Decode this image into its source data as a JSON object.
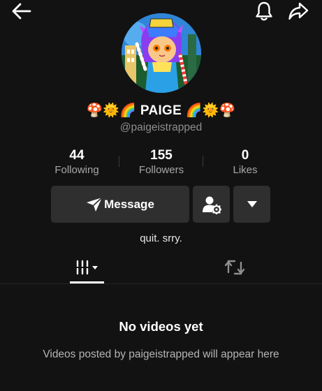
{
  "profile": {
    "display_name": "🍄🌞🌈 PAIGE 🌈🌞🍄",
    "handle": "@paigeistrapped",
    "bio": "quit. srry."
  },
  "stats": {
    "following_count": "44",
    "following_label": "Following",
    "followers_count": "155",
    "followers_label": "Followers",
    "likes_count": "0",
    "likes_label": "Likes"
  },
  "actions": {
    "message_label": "Message"
  },
  "empty_state": {
    "title": "No videos yet",
    "subtitle": "Videos posted by paigeistrapped will appear here"
  },
  "icons": {
    "back": "back-arrow-icon",
    "bell": "bell-icon",
    "share": "share-icon",
    "message": "paper-plane-icon",
    "add_friend": "person-gear-icon",
    "more": "triangle-down-icon",
    "videos_tab": "grid-bars-icon",
    "reposts_tab": "repost-icon"
  },
  "colors": {
    "background": "#121212",
    "button": "#2f2f2f",
    "secondary_text": "#8e8e8e"
  }
}
